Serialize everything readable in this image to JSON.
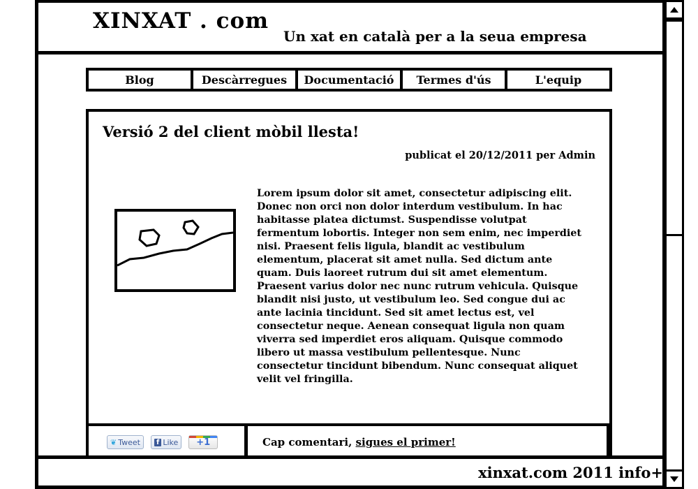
{
  "site": {
    "logo": "XINXAT . com",
    "tagline": "Un xat en català per a la seua empresa"
  },
  "nav": {
    "items": [
      "Blog",
      "Descàrregues",
      "Documentació",
      "Termes d'ús",
      "L'equip"
    ]
  },
  "post": {
    "title": "Versió 2 del client mòbil llesta!",
    "meta": "publicat el 20/12/2011 per Admin",
    "image_icon": "image-placeholder-icon",
    "body": "Lorem ipsum dolor sit amet, consectetur adipiscing elit. Donec non orci non dolor interdum vestibulum. In hac habitasse platea dictumst. Suspendisse volutpat fermentum lobortis. Integer non sem enim, nec imperdiet nisi. Praesent felis ligula, blandit ac vestibulum elementum, placerat sit amet nulla. Sed dictum ante quam. Duis laoreet rutrum dui sit amet elementum. Praesent varius dolor nec nunc rutrum vehicula. Quisque blandit nisi justo, ut vestibulum leo. Sed congue dui ac ante lacinia tincidunt. Sed sit amet lectus est, vel consectetur neque. Aenean consequat ligula non quam viverra sed imperdiet eros aliquam. Quisque commodo libero ut massa vestibulum pellentesque. Nunc consectetur tincidunt bibendum. Nunc consequat aliquet velit vel fringilla."
  },
  "social": {
    "tweet": "Tweet",
    "like": "Like",
    "plusone": "+1"
  },
  "comments": {
    "text": "Cap comentari, ",
    "link": "sigues el primer!"
  },
  "footer": {
    "text": "xinxat.com 2011 info+"
  }
}
